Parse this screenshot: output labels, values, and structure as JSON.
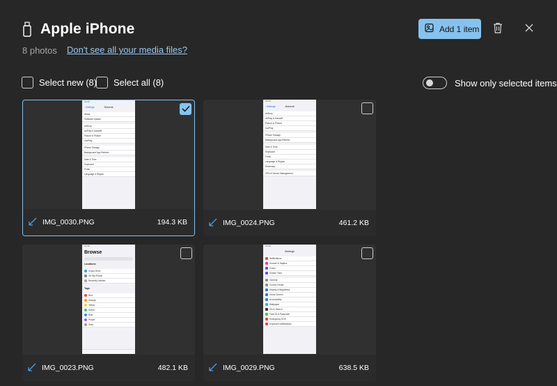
{
  "header": {
    "device_icon": "usb-drive-icon",
    "title": "Apple iPhone",
    "photo_count": "8 photos",
    "media_link": "Don't see all your media files?"
  },
  "actions": {
    "add_label": "Add 1 item",
    "add_icon": "add-photo-icon",
    "delete_icon": "trash-icon",
    "close_icon": "close-icon"
  },
  "filters": {
    "select_new": "Select new (8)",
    "select_all": "Select all (8)",
    "show_only_selected": "Show only selected items",
    "show_only_selected_on": false
  },
  "photos": [
    {
      "name": "IMG_0030.PNG",
      "size": "194.3 KB",
      "selected": true
    },
    {
      "name": "IMG_0024.PNG",
      "size": "461.2 KB",
      "selected": false
    },
    {
      "name": "IMG_0023.PNG",
      "size": "482.1 KB",
      "selected": false
    },
    {
      "name": "IMG_0029.PNG",
      "size": "638.5 KB",
      "selected": false
    }
  ],
  "colors": {
    "background": "#272727",
    "accent": "#86c2ee",
    "link": "#99c7f2",
    "card": "#303030"
  }
}
